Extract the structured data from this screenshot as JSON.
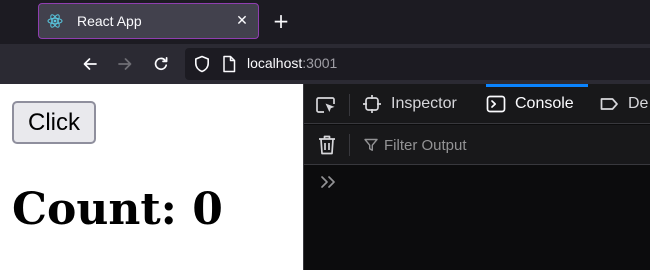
{
  "tab": {
    "title": "React App",
    "icon": "react-logo-icon",
    "close": "✕"
  },
  "new_tab": "+",
  "nav": {
    "back_icon": "back-arrow-icon",
    "forward_icon": "forward-arrow-icon",
    "reload_icon": "reload-icon",
    "url_host": "localhost",
    "url_port": ":3001"
  },
  "page": {
    "button_label": "Click",
    "count_text": "Count: 0"
  },
  "devtools": {
    "tabs": [
      {
        "label": "",
        "icon": "element-picker-icon"
      },
      {
        "label": "Inspector",
        "icon": "inspector-icon"
      },
      {
        "label": "Console",
        "icon": "console-icon",
        "active": true
      },
      {
        "label": "De",
        "icon": "debugger-icon"
      }
    ],
    "filter_placeholder": "Filter Output",
    "prompt": "»"
  },
  "colors": {
    "accent": "#0a84ff",
    "tab_border": "#8f3eb0",
    "toolbar_bg": "#18181a",
    "console_bg": "#0c0c0d"
  }
}
